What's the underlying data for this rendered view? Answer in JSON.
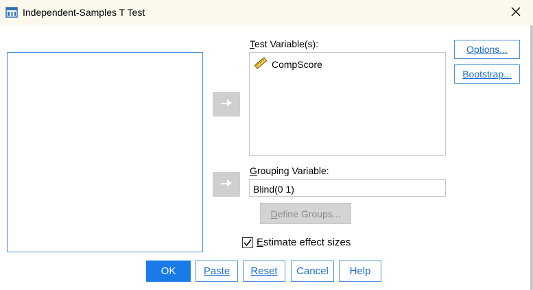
{
  "window": {
    "title": "Independent-Samples T Test",
    "icon": "spss-dialog-icon",
    "close_icon": "close-icon"
  },
  "source_list": {
    "items": []
  },
  "test_variables": {
    "label_key": "T",
    "label_rest": "est Variable(s):",
    "items": [
      {
        "name": "CompScore",
        "icon": "ruler-scale-icon"
      }
    ]
  },
  "grouping": {
    "label_key": "G",
    "label_rest": "rouping Variable:",
    "value": "Blind(0 1)"
  },
  "define_groups": {
    "label_key": "D",
    "label_rest": "efine Groups..."
  },
  "side_buttons": {
    "options_key": "O",
    "options_rest": "ptions...",
    "bootstrap_key": "B",
    "bootstrap_rest": "ootstrap..."
  },
  "effect_sizes": {
    "checked": true,
    "label_key": "E",
    "label_rest": "stimate effect sizes"
  },
  "buttons": {
    "ok": "OK",
    "paste_key": "P",
    "paste_rest": "aste",
    "reset_key": "R",
    "reset_rest": "eset",
    "cancel": "Cancel",
    "help": "Help"
  },
  "colors": {
    "accent": "#1a7ae8",
    "link": "#1a6fc9",
    "titlebar": "#fbf8ec",
    "arrow_button": "#cfcfcf"
  }
}
